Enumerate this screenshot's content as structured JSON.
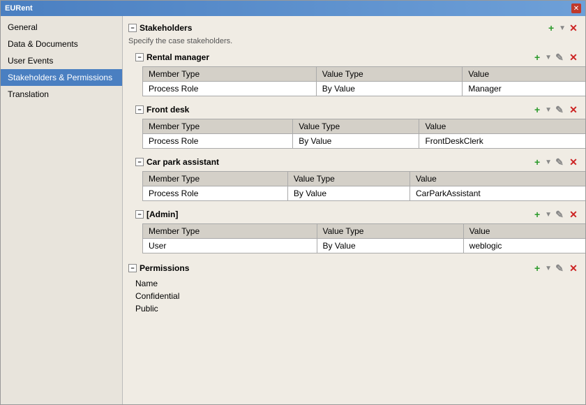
{
  "titleBar": {
    "title": "EURent",
    "closeLabel": "✕"
  },
  "sidebar": {
    "items": [
      {
        "id": "general",
        "label": "General",
        "active": false
      },
      {
        "id": "data-documents",
        "label": "Data & Documents",
        "active": false
      },
      {
        "id": "user-events",
        "label": "User Events",
        "active": false
      },
      {
        "id": "stakeholders",
        "label": "Stakeholders & Permissions",
        "active": true
      },
      {
        "id": "translation",
        "label": "Translation",
        "active": false
      }
    ]
  },
  "content": {
    "stakeholders": {
      "sectionTitle": "Stakeholders",
      "description": "Specify the case stakeholders.",
      "collapseSymbol": "−",
      "subsections": [
        {
          "id": "rental-manager",
          "title": "Rental manager",
          "collapseSymbol": "−",
          "columns": [
            "Member Type",
            "Value Type",
            "Value"
          ],
          "rows": [
            {
              "memberType": "Process Role",
              "valueType": "By Value",
              "value": "Manager"
            }
          ]
        },
        {
          "id": "front-desk",
          "title": "Front desk",
          "collapseSymbol": "−",
          "columns": [
            "Member Type",
            "Value Type",
            "Value"
          ],
          "rows": [
            {
              "memberType": "Process Role",
              "valueType": "By Value",
              "value": "FrontDeskClerk"
            }
          ]
        },
        {
          "id": "car-park-assistant",
          "title": "Car park assistant",
          "collapseSymbol": "−",
          "columns": [
            "Member Type",
            "Value Type",
            "Value"
          ],
          "rows": [
            {
              "memberType": "Process Role",
              "valueType": "By Value",
              "value": "CarParkAssistant"
            }
          ]
        },
        {
          "id": "admin",
          "title": "[Admin]",
          "collapseSymbol": "−",
          "columns": [
            "Member Type",
            "Value Type",
            "Value"
          ],
          "rows": [
            {
              "memberType": "User",
              "valueType": "By Value",
              "value": "weblogic"
            }
          ]
        }
      ]
    },
    "permissions": {
      "sectionTitle": "Permissions",
      "collapseSymbol": "−",
      "items": [
        "Name",
        "Confidential",
        "Public"
      ]
    }
  },
  "icons": {
    "add": "+",
    "addArrow": "▼",
    "edit": "✎",
    "delete": "✕",
    "collapse": "−"
  }
}
